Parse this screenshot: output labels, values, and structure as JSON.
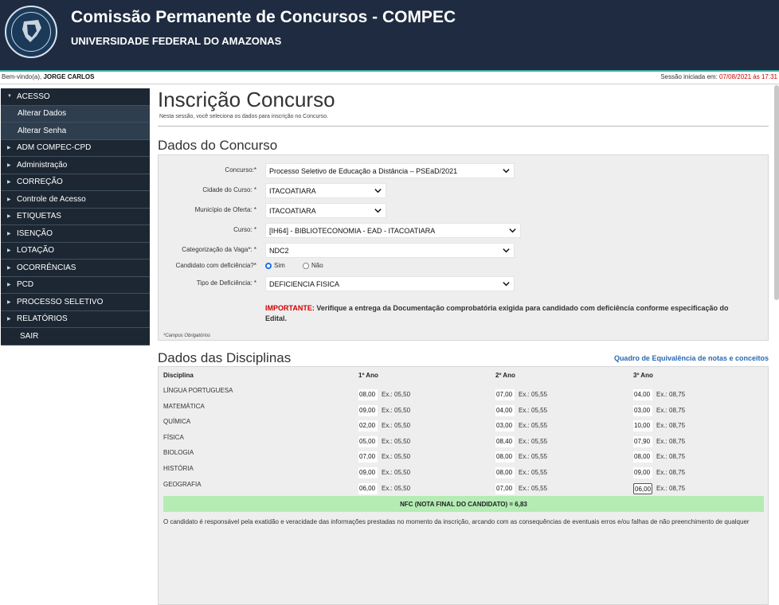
{
  "header": {
    "title": "Comissão Permanente de Concursos - COMPEC",
    "subtitle": "UNIVERSIDADE FEDERAL DO AMAZONAS"
  },
  "session": {
    "welcome_prefix": "Bem-vindo(a),",
    "user": "JORGE CARLOS",
    "started_label": "Sessão iniciada em:",
    "started_at": "07/08/2021 às 17:31"
  },
  "sidebar": {
    "items": [
      {
        "label": "ACESSO",
        "arrow": "▼"
      },
      {
        "label": "Alterar Dados"
      },
      {
        "label": "Alterar Senha"
      },
      {
        "label": "ADM COMPEC-CPD",
        "arrow": "▶"
      },
      {
        "label": "Administração",
        "arrow": "▶"
      },
      {
        "label": "CORREÇÃO",
        "arrow": "▶"
      },
      {
        "label": "Controle de Acesso",
        "arrow": "▶"
      },
      {
        "label": "ETIQUETAS",
        "arrow": "▶"
      },
      {
        "label": "ISENÇÃO",
        "arrow": "▶"
      },
      {
        "label": "LOTAÇÃO",
        "arrow": "▶"
      },
      {
        "label": "OCORRÊNCIAS",
        "arrow": "▶"
      },
      {
        "label": "PCD",
        "arrow": "▶"
      },
      {
        "label": "PROCESSO SELETIVO",
        "arrow": "▶"
      },
      {
        "label": "RELATÓRIOS",
        "arrow": "▶"
      },
      {
        "label": "SAIR"
      }
    ]
  },
  "page": {
    "title": "Inscrição Concurso",
    "description": "Nesta sessão, você seleciona os dados para inscrição no Concurso."
  },
  "concurso": {
    "section_title": "Dados do Concurso",
    "fields": {
      "concurso": {
        "label": "Concurso:*",
        "value": "Processo Seletivo de Educação a Distância – PSEaD/2021"
      },
      "cidade": {
        "label": "Cidade do Curso: *",
        "value": "ITACOATIARA"
      },
      "municipio": {
        "label": "Município de Oferta: *",
        "value": "ITACOATIARA"
      },
      "curso": {
        "label": "Curso: *",
        "value": "[IH64] - BIBLIOTECONOMIA - EAD - ITACOATIARA"
      },
      "categorizacao": {
        "label": "Categorização da Vaga*: *",
        "value": "NDC2"
      },
      "deficiencia": {
        "label": "Candidato com deficiência?*",
        "sim": "Sim",
        "nao": "Não"
      },
      "tipo": {
        "label": "Tipo de Deficiência: *",
        "value": "DEFICIENCIA FISICA"
      }
    },
    "important_label": "IMPORTANTE:",
    "important_text": " Verifique a entrega da Documentação comprobatória exigida para candidado com deficiência conforme especificação do Edital.",
    "required_note": "*Campos Obrigatórios"
  },
  "disciplinas": {
    "section_title": "Dados das Disciplinas",
    "equiv_link": "Quadro de Equivalência de notas e conceitos",
    "headers": [
      "Disciplina",
      "1º Ano",
      "2º Ano",
      "3º Ano"
    ],
    "rows": [
      {
        "name": "LÍNGUA PORTUGUESA",
        "grades": [
          {
            "v": "08,00",
            "ex": "Ex.: 05,50"
          },
          {
            "v": "07,00",
            "ex": "Ex.: 05,55"
          },
          {
            "v": "04,00",
            "ex": "Ex.: 08,75"
          }
        ]
      },
      {
        "name": "MATEMÁTICA",
        "grades": [
          {
            "v": "09,00",
            "ex": "Ex.: 05,50"
          },
          {
            "v": "04,00",
            "ex": "Ex.: 05,55"
          },
          {
            "v": "03,00",
            "ex": "Ex.: 08,75"
          }
        ]
      },
      {
        "name": "QUÍMICA",
        "grades": [
          {
            "v": "02,00",
            "ex": "Ex.: 05,50"
          },
          {
            "v": "03,00",
            "ex": "Ex.: 05,55"
          },
          {
            "v": "10,00",
            "ex": "Ex.: 08,75"
          }
        ]
      },
      {
        "name": "FÍSICA",
        "grades": [
          {
            "v": "05,00",
            "ex": "Ex.: 05,50"
          },
          {
            "v": "08,40",
            "ex": "Ex.: 05,55"
          },
          {
            "v": "07,90",
            "ex": "Ex.: 08,75"
          }
        ]
      },
      {
        "name": "BIOLOGIA",
        "grades": [
          {
            "v": "07,00",
            "ex": "Ex.: 05,50"
          },
          {
            "v": "08,00",
            "ex": "Ex.: 05,55"
          },
          {
            "v": "08,00",
            "ex": "Ex.: 08,75"
          }
        ]
      },
      {
        "name": "HISTÓRIA",
        "grades": [
          {
            "v": "09,00",
            "ex": "Ex.: 05,50"
          },
          {
            "v": "08,00",
            "ex": "Ex.: 05,55"
          },
          {
            "v": "09,00",
            "ex": "Ex.: 08,75"
          }
        ]
      },
      {
        "name": "GEOGRAFIA",
        "grades": [
          {
            "v": "06,00",
            "ex": "Ex.: 05,50"
          },
          {
            "v": "07,00",
            "ex": "Ex.: 05,55"
          },
          {
            "v": "06,00",
            "ex": "Ex.: 08,75"
          }
        ]
      }
    ],
    "nfc": "NFC (NOTA FINAL DO CANDIDATO) = 6,83",
    "bottom_text": "O candidato é responsável pela exatidão e veracidade das informações prestadas no momento da inscrição, arcando com as consequências de eventuais erros e/ou falhas de não preenchimento de qualquer"
  }
}
